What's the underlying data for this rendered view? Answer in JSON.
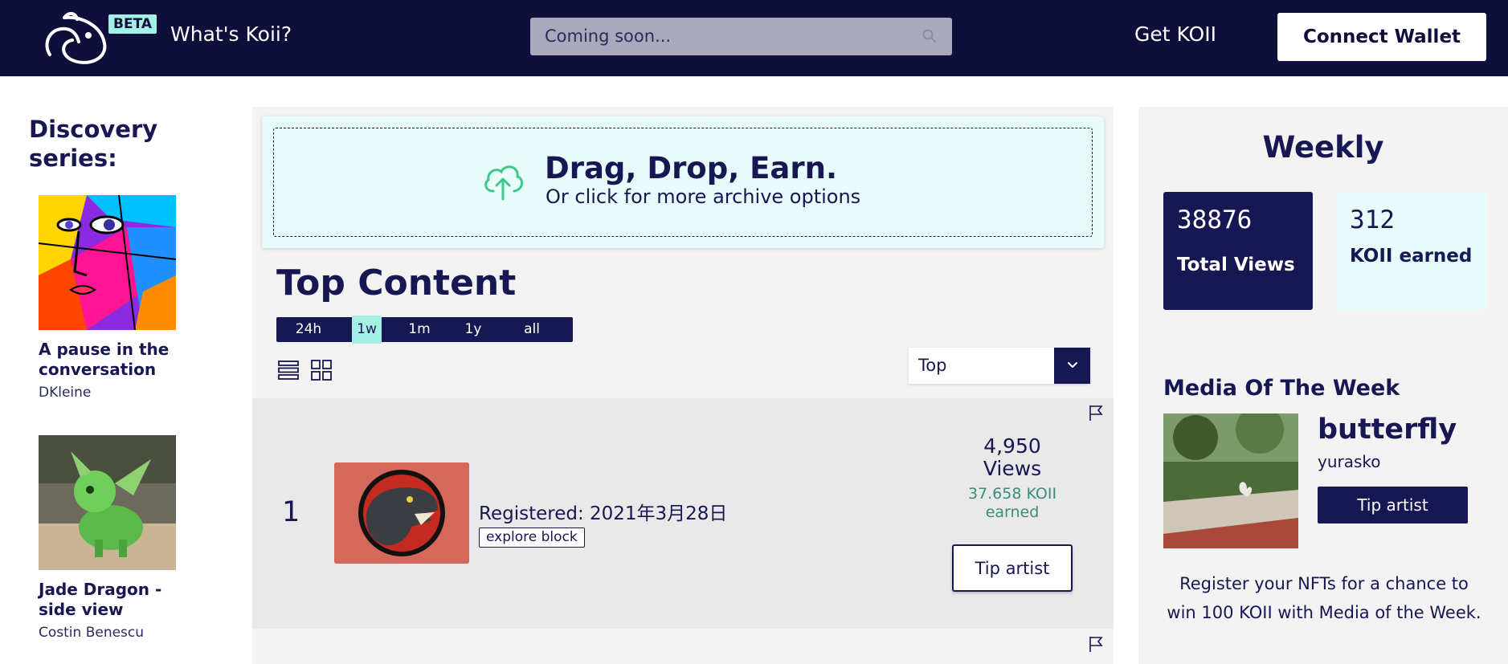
{
  "header": {
    "beta_label": "BETA",
    "whats_koii": "What's Koii?",
    "search_placeholder": "Coming soon...",
    "get_koii": "Get KOII",
    "connect_wallet": "Connect Wallet"
  },
  "discovery": {
    "title": "Discovery series:",
    "items": [
      {
        "name": "A pause in the conversation",
        "author": "DKleine"
      },
      {
        "name": "Jade Dragon - side view",
        "author": "Costin Benescu"
      }
    ]
  },
  "upload": {
    "headline": "Drag, Drop, Earn.",
    "subline": "Or click for more archive options"
  },
  "top_content": {
    "title": "Top Content",
    "ranges": [
      "24h",
      "1w",
      "1m",
      "1y",
      "all"
    ],
    "active_range": "1w",
    "sort_value": "Top"
  },
  "entries": [
    {
      "rank": "1",
      "registered": "Registered: 2021年3月28日",
      "explore_label": "explore block",
      "views_count": "4,950",
      "views_label": "Views",
      "koii_amount": "37.658 KOII",
      "koii_label": "earned",
      "tip_label": "Tip artist"
    }
  ],
  "weekly": {
    "title": "Weekly",
    "total_views_value": "38876",
    "total_views_label": "Total Views",
    "koii_earned_value": "312",
    "koii_earned_label": "KOII earned"
  },
  "media_of_week": {
    "title": "Media Of The Week",
    "name": "butterfly",
    "author": "yurasko",
    "tip_label": "Tip artist",
    "promo": "Register your NFTs for a chance to win 100 KOII with Media of the Week."
  },
  "colors": {
    "navy": "#0f0f3c",
    "accent": "#171753",
    "mint": "#a4f0e4",
    "panel": "#f3f3f3",
    "earned_green": "#3b8c7a"
  }
}
